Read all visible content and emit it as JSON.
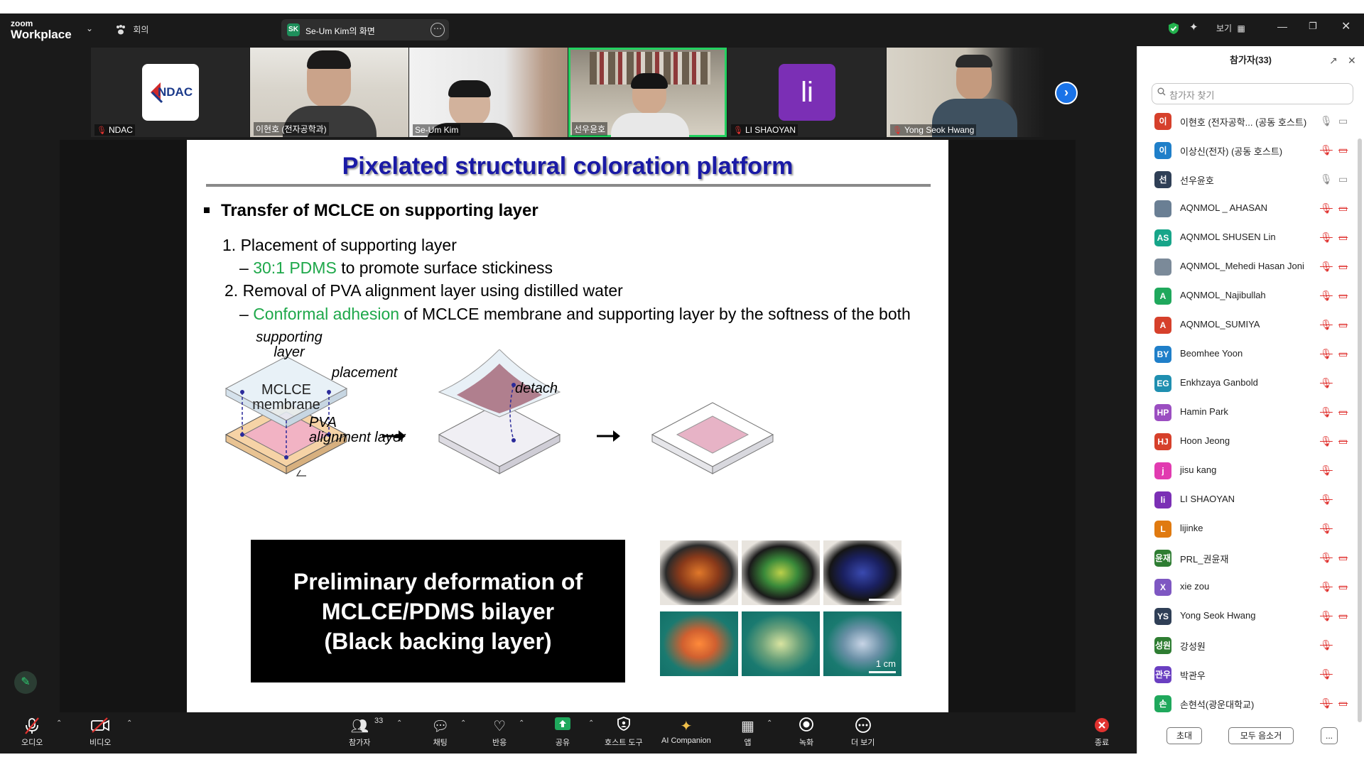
{
  "app": {
    "logo_top": "zoom",
    "logo_bottom": "Workplace",
    "meeting_label": "회의"
  },
  "share": {
    "initials": "SK",
    "label": "Se-Um Kim의 화면"
  },
  "view_label": "보기",
  "thumbnails": [
    {
      "name": "NDAC",
      "muted": true,
      "logo_text": "NDAC"
    },
    {
      "name": "이현호 (전자공학과)",
      "muted": false
    },
    {
      "name": "Se-Um Kim",
      "muted": false
    },
    {
      "name": "선우윤호",
      "muted": false,
      "active": true
    },
    {
      "name": "LI SHAOYAN",
      "muted": true,
      "avatar": "li"
    },
    {
      "name": "Yong Seok Hwang",
      "muted": true
    }
  ],
  "slide": {
    "title": "Pixelated structural coloration platform",
    "bullet": "Transfer of MCLCE on supporting layer",
    "line1": "1. Placement of supporting layer",
    "line1_sub_dash": "–",
    "line1_sub_green": "30:1 PDMS",
    "line1_sub_rest": "to promote surface stickiness",
    "line2": "2. Removal of PVA alignment layer using distilled water",
    "line2_sub_dash": "–",
    "line2_sub_green": "Conformal adhesion",
    "line2_sub_rest": "of MCLCE membrane and supporting layer by the softness of the both",
    "label_supporting": "supporting\nlayer",
    "label_placement": "placement",
    "label_mclce": "MCLCE\nmembrane",
    "label_pva": "PVA\nalignment layer",
    "label_detach": "detach",
    "box_text_1": "Preliminary deformation of",
    "box_text_2": "MCLCE/PDMS bilayer",
    "box_text_3": "(Black backing layer)",
    "scale_label": "1 cm"
  },
  "panel": {
    "title": "참가자(33)",
    "search_placeholder": "참가자 찾기",
    "participants": [
      {
        "initials": "이",
        "color": "#d6402b",
        "name": "이현호 (전자공학... (공동 호스트)",
        "mic": "on",
        "cam": "on"
      },
      {
        "initials": "이",
        "color": "#1f7fc9",
        "name": "이상신(전자) (공동 호스트)",
        "mic": "off",
        "cam": "off"
      },
      {
        "initials": "선",
        "color": "#2f3f56",
        "name": "선우윤호",
        "mic": "on",
        "cam": "on"
      },
      {
        "initials": "",
        "color": "#6a7f94",
        "name": "AQNMOL _ AHASAN",
        "mic": "off",
        "cam": "off"
      },
      {
        "initials": "AS",
        "color": "#17a589",
        "name": "AQNMOL SHUSEN Lin",
        "mic": "off",
        "cam": "off"
      },
      {
        "initials": "",
        "color": "#7b8a99",
        "name": "AQNMOL_Mehedi Hasan Joni",
        "mic": "off",
        "cam": "off"
      },
      {
        "initials": "A",
        "color": "#1fa85c",
        "name": "AQNMOL_Najibullah",
        "mic": "off",
        "cam": "off"
      },
      {
        "initials": "A",
        "color": "#d6402b",
        "name": "AQNMOL_SUMIYA",
        "mic": "off",
        "cam": "off"
      },
      {
        "initials": "BY",
        "color": "#1f7fc9",
        "name": "Beomhee Yoon",
        "mic": "off",
        "cam": "off"
      },
      {
        "initials": "EG",
        "color": "#1f8fb0",
        "name": "Enkhzaya Ganbold",
        "mic": "off",
        "cam": ""
      },
      {
        "initials": "HP",
        "color": "#9b4ec1",
        "name": "Hamin Park",
        "mic": "off",
        "cam": "off"
      },
      {
        "initials": "HJ",
        "color": "#d6402b",
        "name": "Hoon Jeong",
        "mic": "off",
        "cam": "off"
      },
      {
        "initials": "j",
        "color": "#e13bb0",
        "name": "jisu kang",
        "mic": "off",
        "cam": ""
      },
      {
        "initials": "li",
        "color": "#7b2fb5",
        "name": "LI SHAOYAN",
        "mic": "off",
        "cam": ""
      },
      {
        "initials": "L",
        "color": "#e07a10",
        "name": "lijinke",
        "mic": "off",
        "cam": ""
      },
      {
        "initials": "윤재",
        "color": "#2e7d32",
        "name": "PRL_권윤재",
        "mic": "off",
        "cam": "off"
      },
      {
        "initials": "X",
        "color": "#7e57c2",
        "name": "xie zou",
        "mic": "off",
        "cam": "off"
      },
      {
        "initials": "YS",
        "color": "#2f3f56",
        "name": "Yong Seok Hwang",
        "mic": "off",
        "cam": "off"
      },
      {
        "initials": "성원",
        "color": "#2e7d32",
        "name": "강성원",
        "mic": "off",
        "cam": ""
      },
      {
        "initials": "관우",
        "color": "#6a3fc1",
        "name": "박관우",
        "mic": "off",
        "cam": ""
      },
      {
        "initials": "손",
        "color": "#1fa85c",
        "name": "손현석(광운대학교)",
        "mic": "off",
        "cam": "off"
      }
    ],
    "invite_label": "초대",
    "mute_all_label": "모두 음소거",
    "more_label": "..."
  },
  "toolbar": {
    "audio": "오디오",
    "video": "비디오",
    "participants": "참가자",
    "participants_count": "33",
    "chat": "채팅",
    "reactions": "반응",
    "share": "공유",
    "host_tools": "호스트 도구",
    "ai": "AI Companion",
    "apps": "앱",
    "record": "녹화",
    "more": "더 보기",
    "end": "종료"
  },
  "colors": {
    "accent": "#1a73e8",
    "share_green": "#1fa85c",
    "danger": "#e0322f",
    "slide_title": "#1a1aa6"
  }
}
